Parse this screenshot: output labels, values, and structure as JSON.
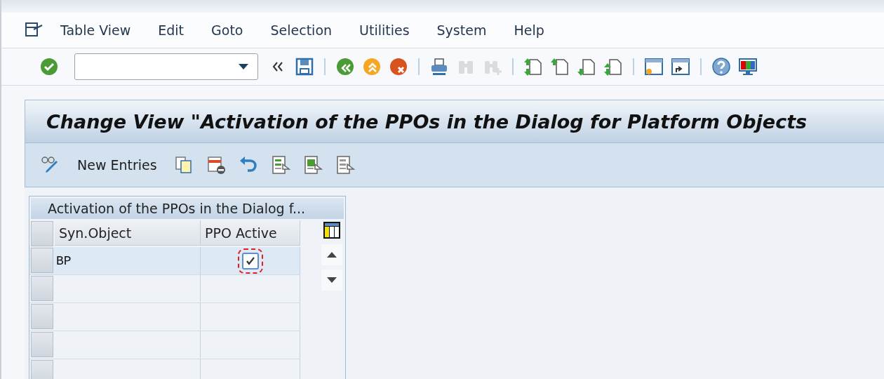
{
  "menu": [
    {
      "label": "Table View"
    },
    {
      "label": "Edit"
    },
    {
      "label": "Goto"
    },
    {
      "label": "Selection"
    },
    {
      "label": "Utilities"
    },
    {
      "label": "System"
    },
    {
      "label": "Help"
    }
  ],
  "toolbar": [
    {
      "kind": "enter",
      "disabled": false
    },
    {
      "kind": "command-field"
    },
    {
      "kind": "collapse"
    },
    {
      "kind": "save",
      "disabled": false
    },
    {
      "kind": "sep"
    },
    {
      "kind": "back",
      "disabled": false
    },
    {
      "kind": "exit",
      "disabled": false
    },
    {
      "kind": "cancel",
      "disabled": false
    },
    {
      "kind": "sep"
    },
    {
      "kind": "print",
      "disabled": false
    },
    {
      "kind": "find",
      "disabled": true
    },
    {
      "kind": "find-next",
      "disabled": true
    },
    {
      "kind": "sep"
    },
    {
      "kind": "first-page",
      "disabled": false
    },
    {
      "kind": "prev-page",
      "disabled": false
    },
    {
      "kind": "next-page",
      "disabled": false
    },
    {
      "kind": "last-page",
      "disabled": false
    },
    {
      "kind": "sep"
    },
    {
      "kind": "new-session",
      "disabled": false
    },
    {
      "kind": "shortcut",
      "disabled": false
    },
    {
      "kind": "sep"
    },
    {
      "kind": "help",
      "disabled": false
    },
    {
      "kind": "layout",
      "disabled": false
    }
  ],
  "title": "Change View \"Activation of the PPOs in the Dialog for Platform Objects",
  "app_toolbar": [
    {
      "kind": "display-change"
    },
    {
      "kind": "text",
      "label": "New Entries"
    },
    {
      "kind": "copy"
    },
    {
      "kind": "delete"
    },
    {
      "kind": "undo"
    },
    {
      "kind": "select-all"
    },
    {
      "kind": "select-block"
    },
    {
      "kind": "deselect-all"
    }
  ],
  "table": {
    "title": "Activation of the PPOs in the Dialog f...",
    "columns": [
      "Syn.Object",
      "PPO Active"
    ],
    "rows": [
      {
        "syn_object": "BP",
        "ppo_active": true,
        "focused": true
      },
      {
        "syn_object": null,
        "ppo_active": null,
        "focused": false
      },
      {
        "syn_object": null,
        "ppo_active": null,
        "focused": false
      },
      {
        "syn_object": null,
        "ppo_active": null,
        "focused": false
      },
      {
        "syn_object": null,
        "ppo_active": null,
        "focused": false
      }
    ]
  }
}
